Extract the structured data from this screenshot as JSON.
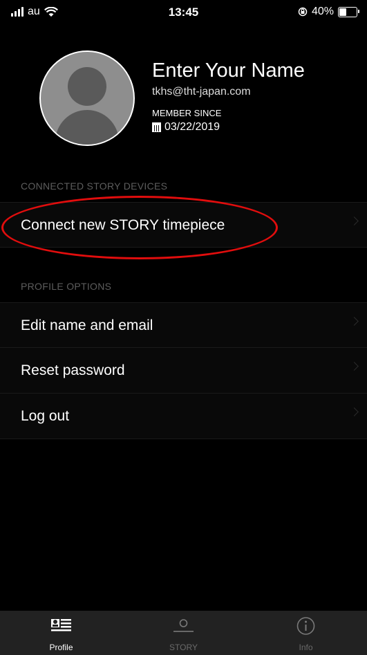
{
  "status_bar": {
    "carrier": "au",
    "time": "13:45",
    "battery_text": "40%",
    "battery_level": 0.4
  },
  "profile": {
    "name": "Enter Your Name",
    "email": "tkhs@tht-japan.com",
    "member_since_label": "MEMBER SINCE",
    "member_since_date": "03/22/2019"
  },
  "sections": {
    "devices_header": "CONNECTED STORY DEVICES",
    "connect_new": "Connect new STORY timepiece",
    "options_header": "PROFILE OPTIONS",
    "edit_name": "Edit name and email",
    "reset_password": "Reset password",
    "log_out": "Log out"
  },
  "tabs": {
    "profile": "Profile",
    "story": "STORY",
    "info": "Info"
  },
  "colors": {
    "annotation": "#e10d0d",
    "background": "#000000",
    "row": "#090909",
    "tabbar": "#222222"
  }
}
